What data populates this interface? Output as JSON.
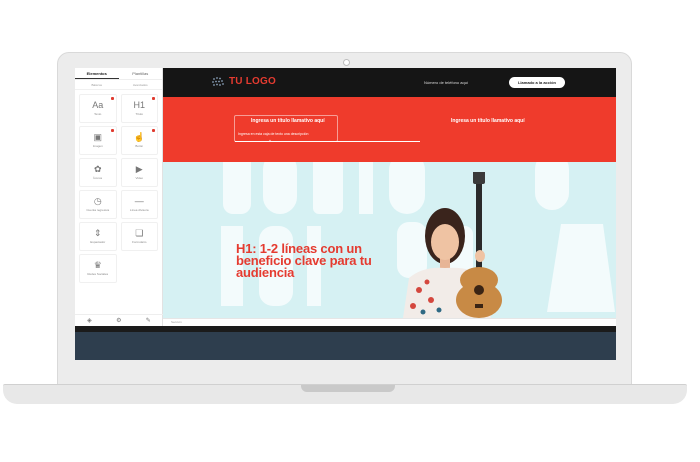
{
  "sidebar": {
    "tabs": [
      {
        "label": "Elementos",
        "active": true
      },
      {
        "label": "Plantillas",
        "active": false
      }
    ],
    "subtabs": [
      "Básicos",
      "Avanzados"
    ],
    "tiles": [
      {
        "icon": "text-icon",
        "glyph": "Aa",
        "label": "Texto",
        "pinned": true
      },
      {
        "icon": "heading-icon",
        "glyph": "H1",
        "label": "Título",
        "pinned": true
      },
      {
        "icon": "image-icon",
        "glyph": "▣",
        "label": "Imagen",
        "pinned": true
      },
      {
        "icon": "button-icon",
        "glyph": "☝",
        "label": "Botón",
        "pinned": true
      },
      {
        "icon": "icons-icon",
        "glyph": "✿",
        "label": "Íconos",
        "pinned": false
      },
      {
        "icon": "video-icon",
        "glyph": "▶",
        "label": "Video",
        "pinned": false
      },
      {
        "icon": "countdown-icon",
        "glyph": "◷",
        "label": "Cuenta regresiva",
        "pinned": false
      },
      {
        "icon": "divider-icon",
        "glyph": "—",
        "label": "Línea divisora",
        "pinned": false
      },
      {
        "icon": "spacer-icon",
        "glyph": "⇕",
        "label": "Espaciador",
        "pinned": false
      },
      {
        "icon": "form-icon",
        "glyph": "❏",
        "label": "Formulario",
        "pinned": false
      },
      {
        "icon": "social-icon",
        "glyph": "♛",
        "label": "Redes Sociales",
        "pinned": false
      }
    ],
    "bottom_icons": [
      {
        "icon": "layers-icon",
        "glyph": "◈"
      },
      {
        "icon": "settings-icon",
        "glyph": "⚙"
      },
      {
        "icon": "brush-icon",
        "glyph": "✎"
      }
    ]
  },
  "topbar": {
    "logo": "TU LOGO",
    "phone": "Número de teléfono aquí",
    "cta": "Llamado a la acción"
  },
  "band": {
    "left_title": "Ingresa un título llamativo aquí",
    "left_sub": "Ingresa en esta caja de texto una descripción",
    "right_title": "Ingresa un título llamativo aquí"
  },
  "hero": {
    "headline": "H1: 1-2 líneas con un beneficio clave para tu audiencia",
    "status": "Sección"
  },
  "colors": {
    "accent": "#ef3b2c",
    "dark": "#151515",
    "hero_bg": "#d6f1f3",
    "footer": "#2e3e4e"
  }
}
